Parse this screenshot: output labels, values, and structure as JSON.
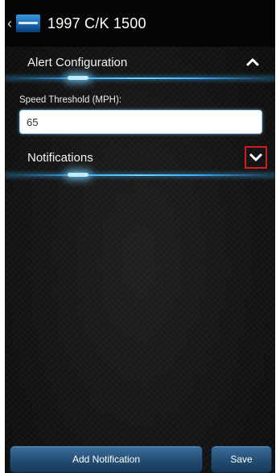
{
  "appbar": {
    "title": "1997 C/K 1500",
    "back_icon": "chevron-left-icon",
    "logo_icon": "app-logo-icon"
  },
  "alert_section": {
    "title": "Alert Configuration",
    "toggle_icon": "chevron-up-icon",
    "state": "expanded"
  },
  "speed_field": {
    "label": "Speed Threshold (MPH):",
    "value": "65"
  },
  "notifications_section": {
    "title": "Notifications",
    "toggle_icon": "chevron-down-icon",
    "state": "collapsed"
  },
  "footer": {
    "add_label": "Add Notification",
    "save_label": "Save"
  },
  "colors": {
    "accent_glow": "#3db2ff",
    "button": "#244d73",
    "highlight_box": "#d11c1c"
  }
}
